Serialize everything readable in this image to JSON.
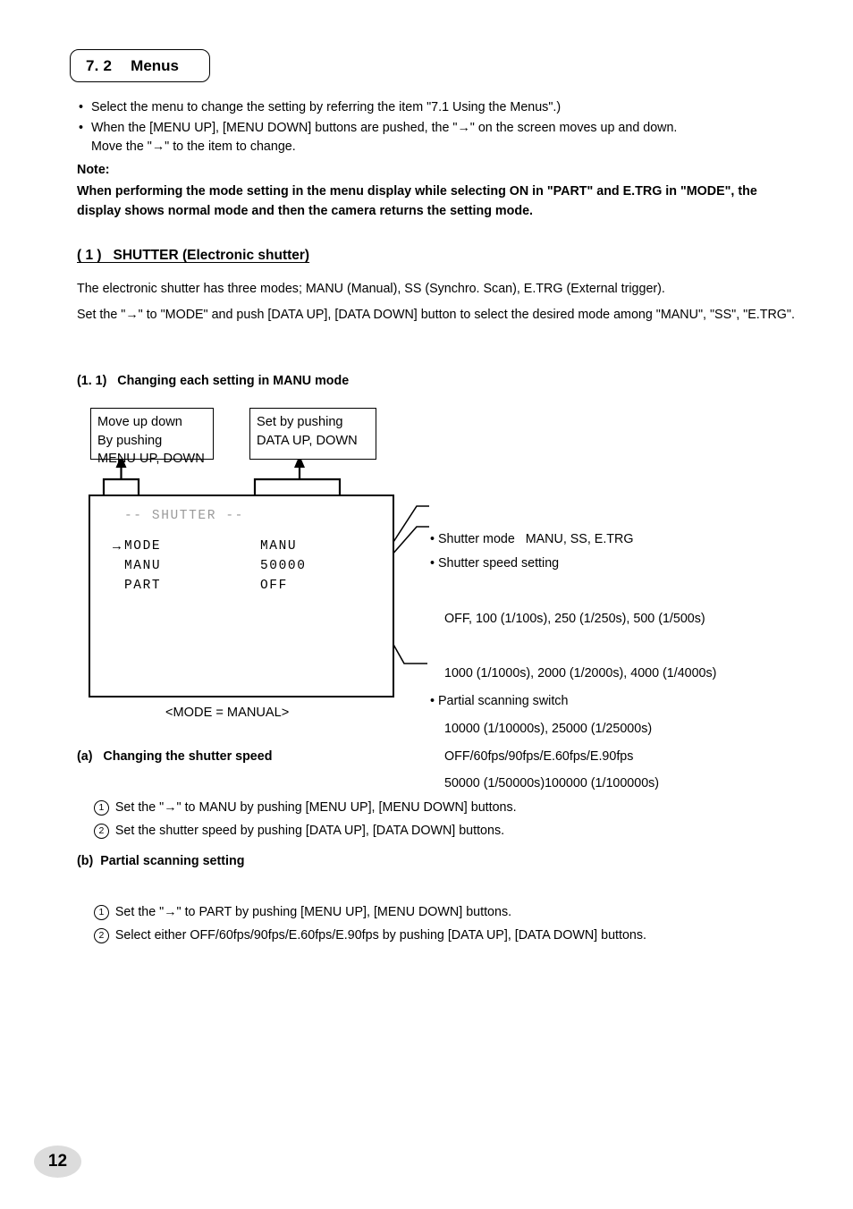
{
  "section": {
    "number": "7. 2",
    "title": "Menus"
  },
  "intro_bullets": [
    "Select the menu to change the setting by referring the item \"7.1 Using the Menus\".)",
    "When the [MENU UP], [MENU DOWN] buttons are pushed, the \"→\" on the screen moves up and down.\nMove the \"→\" to the item to change."
  ],
  "note": {
    "label": "Note:",
    "body": "When performing the mode setting in the menu display while selecting ON in  \"PART\" and E.TRG in \"MODE\", the display shows normal mode and then the camera returns the setting mode."
  },
  "shutter": {
    "heading": "( 1 )   SHUTTER (Electronic shutter)",
    "para1": "The electronic shutter has three modes; MANU (Manual), SS (Synchro. Scan), E.TRG (External trigger).",
    "para2": "Set the \"→\" to \"MODE\" and push [DATA UP], [DATA DOWN] button to select the desired mode among \"MANU\", \"SS\", \"E.TRG\"."
  },
  "manu_section": {
    "heading": "(1. 1)   Changing each setting in MANU mode",
    "callout_menu": "Move up down\nBy pushing\nMENU UP, DOWN",
    "callout_data": "Set by pushing\nDATA UP, DOWN",
    "screen": {
      "title": "-- SHUTTER --",
      "rows": [
        {
          "cursor": "→",
          "label": "MODE",
          "value": "MANU"
        },
        {
          "cursor": "",
          "label": "MANU",
          "value": "50000"
        },
        {
          "cursor": "",
          "label": "PART",
          "value": "OFF"
        }
      ]
    },
    "screen_caption": "<MODE = MANUAL>",
    "annotations": {
      "shutter_mode": "• Shutter mode   MANU, SS, E.TRG",
      "shutter_speed_head": "• Shutter speed setting",
      "shutter_speed_lines": [
        "OFF, 100 (1/100s), 250 (1/250s), 500 (1/500s)",
        "1000 (1/1000s), 2000 (1/2000s), 4000 (1/4000s)",
        "10000 (1/10000s), 25000 (1/25000s)",
        "50000 (1/50000s)100000 (1/100000s)"
      ],
      "partial_head": "• Partial scanning switch",
      "partial_values": "OFF/60fps/90fps/E.60fps/E.90fps"
    }
  },
  "subsection_a": {
    "heading": "(a)   Changing the shutter speed",
    "steps": [
      {
        "num": "1",
        "text": "Set the \"→\" to MANU by pushing [MENU UP], [MENU DOWN] buttons."
      },
      {
        "num": "2",
        "text": "Set the shutter speed by pushing [DATA UP], [DATA DOWN] buttons."
      }
    ]
  },
  "subsection_b": {
    "heading": "(b)  Partial scanning setting",
    "steps": [
      {
        "num": "1",
        "text": "Set the \"→\" to PART by pushing [MENU UP], [MENU DOWN] buttons."
      },
      {
        "num": "2",
        "text": "Select either OFF/60fps/90fps/E.60fps/E.90fps by pushing [DATA UP], [DATA DOWN] buttons."
      }
    ]
  },
  "footer": {
    "page_number": "12"
  }
}
